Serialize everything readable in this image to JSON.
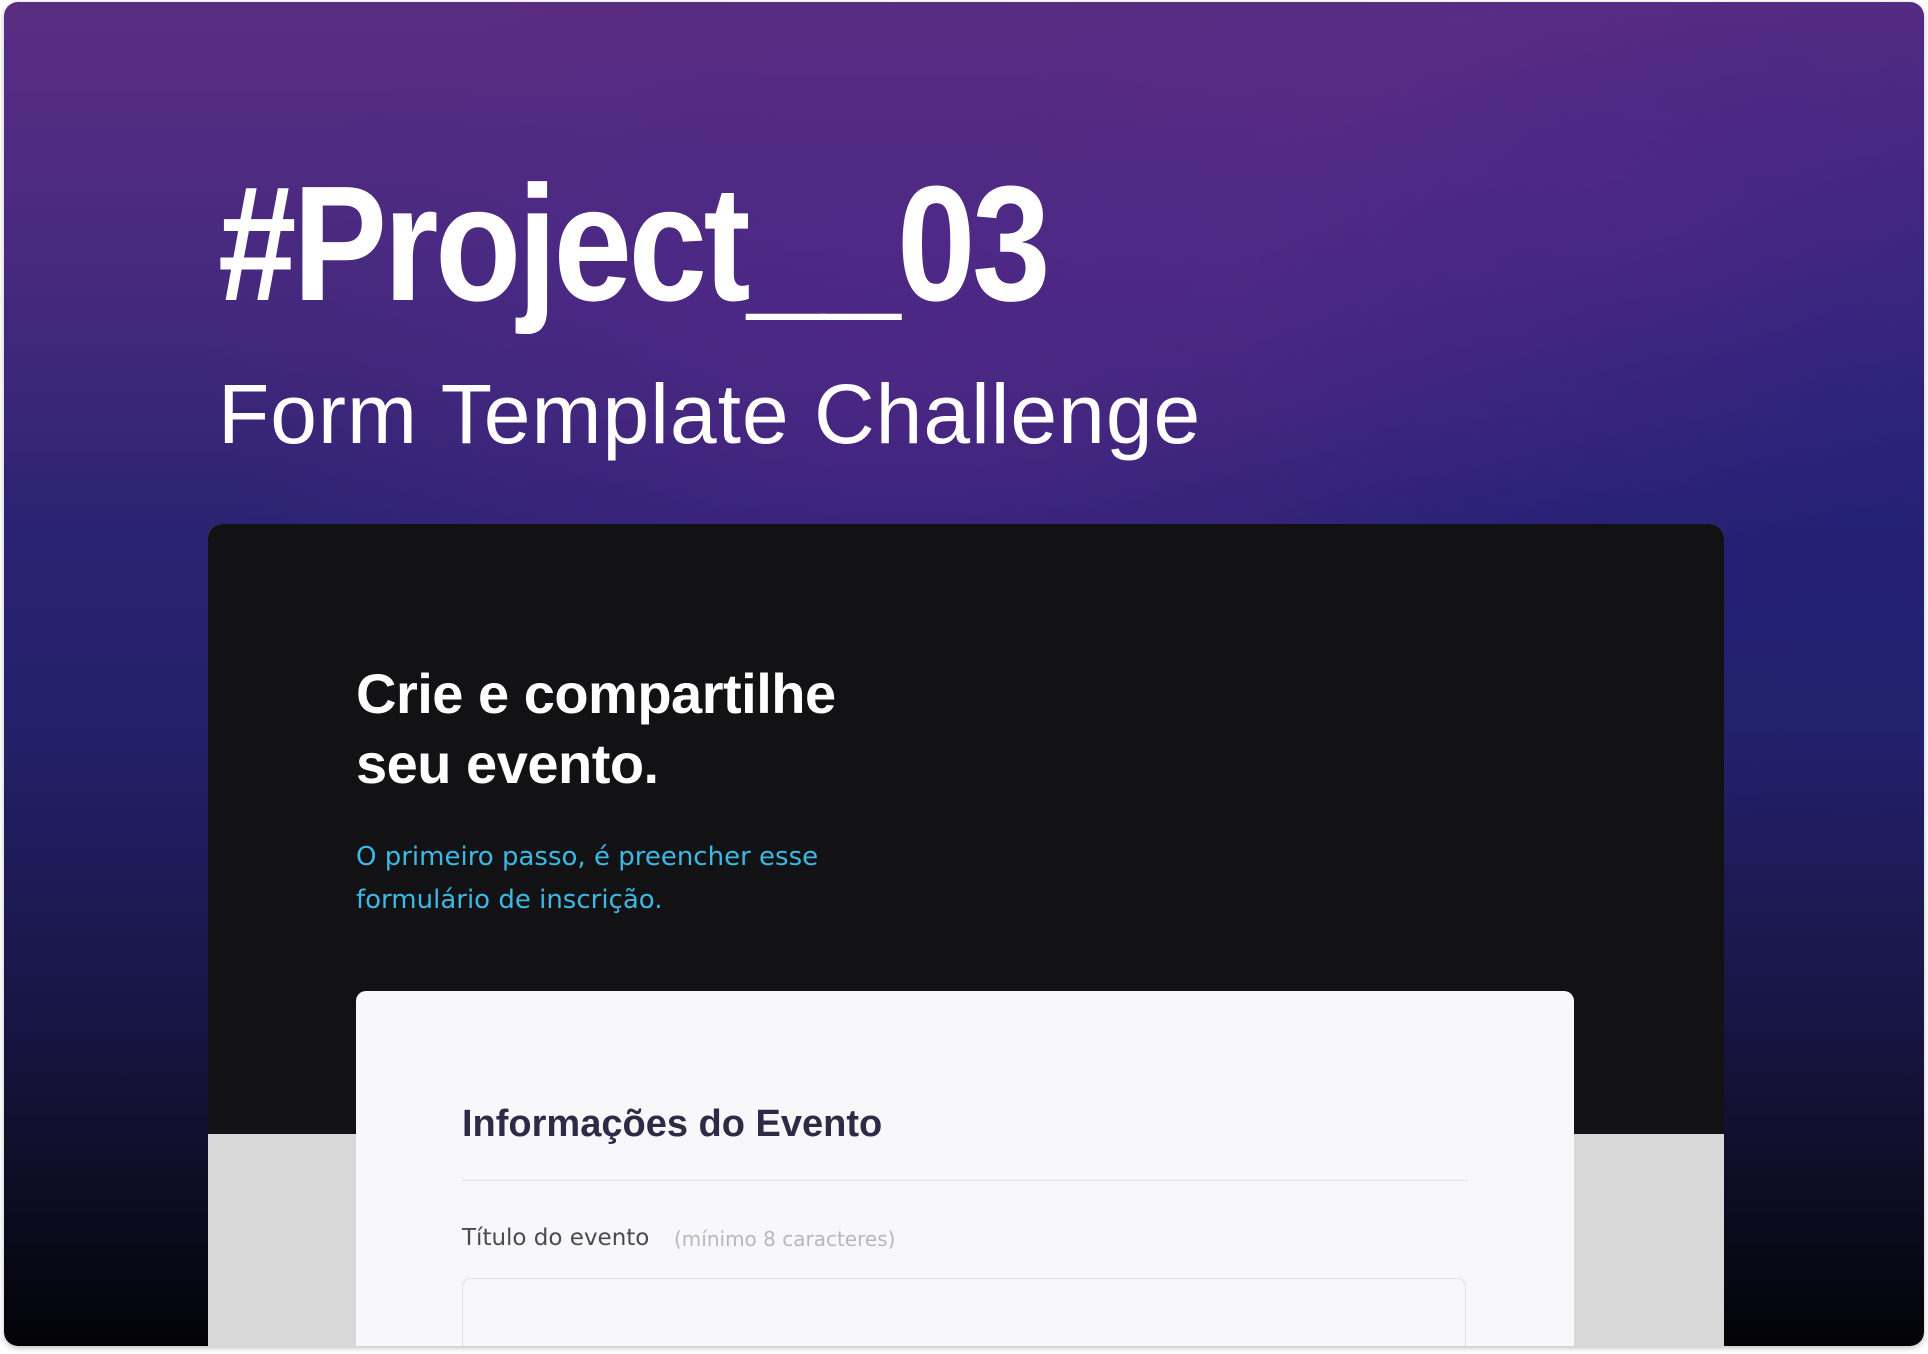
{
  "hero": {
    "title": "#Project__03",
    "subtitle": "Form Template Challenge"
  },
  "preview": {
    "headline_line1": "Crie e compartilhe",
    "headline_line2": "seu evento.",
    "lead_line1": "O primeiro passo, é preencher esse",
    "lead_line2": "formulário de inscrição.",
    "form": {
      "heading": "Informações do Evento",
      "fields": [
        {
          "label": "Título do evento",
          "hint": "(mínimo 8 caracteres)",
          "value": ""
        }
      ]
    }
  },
  "colors": {
    "accent_text": "#3cb8e6",
    "dark_panel": "#121214",
    "form_background": "#f8f8fa",
    "hero_gradient_top": "#5a2d82",
    "hero_gradient_bottom": "#030307"
  }
}
